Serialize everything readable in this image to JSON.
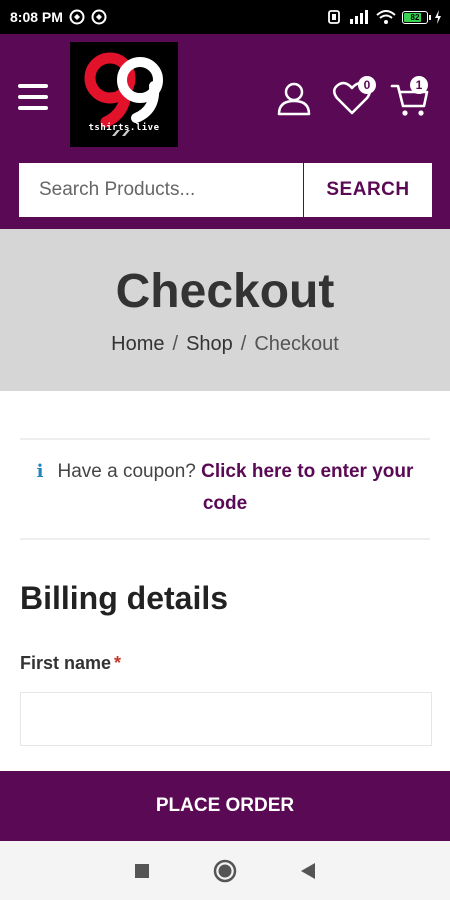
{
  "status_bar": {
    "time": "8:08 PM",
    "battery_level": "82",
    "battery_fraction": 0.82
  },
  "header": {
    "logo_text": "tshirts.live",
    "wishlist_count": "0",
    "cart_count": "1",
    "brand_color": "#5a0a55"
  },
  "search": {
    "placeholder": "Search Products...",
    "button_label": "SEARCH"
  },
  "page": {
    "title": "Checkout",
    "breadcrumb": [
      {
        "label": "Home"
      },
      {
        "label": "Shop"
      },
      {
        "label": "Checkout"
      }
    ],
    "breadcrumb_separator": "/"
  },
  "coupon": {
    "prompt": "Have a coupon?",
    "link_text": "Click here to enter your code"
  },
  "billing": {
    "heading": "Billing details",
    "first_name_label": "First name",
    "required_marker": "*",
    "first_name_value": ""
  },
  "actions": {
    "place_order_label": "PLACE ORDER"
  },
  "icons": {
    "menu": "hamburger-menu-icon",
    "user": "user-account-icon",
    "wishlist": "heart-icon",
    "cart": "shopping-cart-icon",
    "info": "info-icon"
  }
}
